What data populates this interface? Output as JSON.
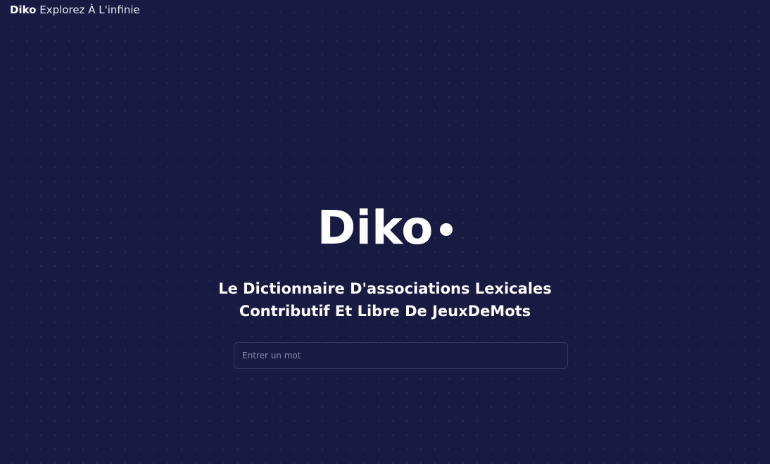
{
  "header": {
    "brand": "Diko",
    "tagline": "Explorez À L'infinie"
  },
  "hero": {
    "logo_text": "Diko",
    "subtitle_line1": "Le Dictionnaire D'associations Lexicales",
    "subtitle_line2": "Contributif Et Libre De JeuxDeMots"
  },
  "search": {
    "value": "",
    "placeholder": "Entrer un mot"
  },
  "colors": {
    "background": "#191a42",
    "text": "#ffffff",
    "input_border": "#33355e"
  }
}
